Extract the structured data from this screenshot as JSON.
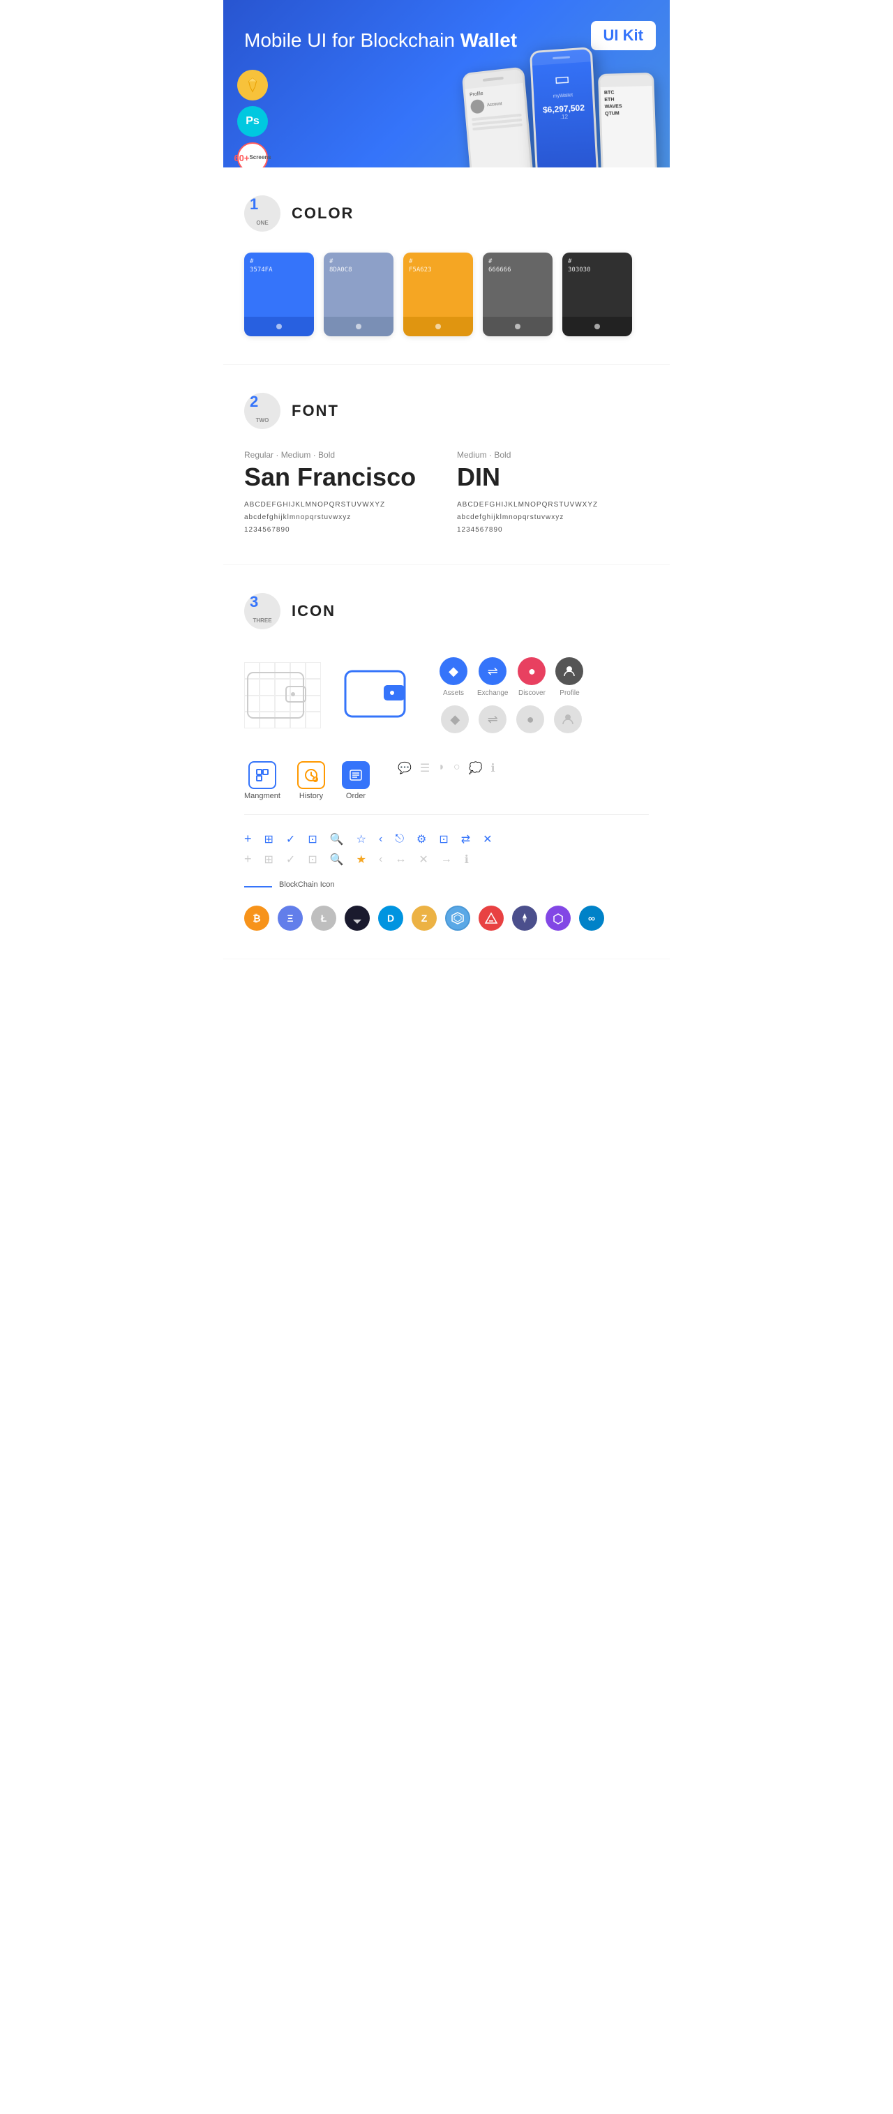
{
  "hero": {
    "title": "Mobile UI for Blockchain ",
    "title_bold": "Wallet",
    "badge": "UI Kit",
    "badges": [
      {
        "type": "sketch",
        "label": "S"
      },
      {
        "type": "ps",
        "label": "Ps"
      },
      {
        "type": "screens",
        "line1": "60+",
        "line2": "Screens"
      }
    ]
  },
  "sections": {
    "color": {
      "number": "1",
      "sub": "ONE",
      "title": "COLOR",
      "swatches": [
        {
          "color": "#3574FA",
          "code": "#\n3574FA"
        },
        {
          "color": "#8DA0C8",
          "code": "#\n8DA0C8"
        },
        {
          "color": "#F5A623",
          "code": "#\nF5A623"
        },
        {
          "color": "#666666",
          "code": "#\n666666"
        },
        {
          "color": "#303030",
          "code": "#\n303030"
        }
      ]
    },
    "font": {
      "number": "2",
      "sub": "TWO",
      "title": "FONT",
      "fonts": [
        {
          "weight_label": "Regular · Medium · Bold",
          "name": "San Francisco",
          "uppercase": "ABCDEFGHIJKLMNOPQRSTUVWXYZ",
          "lowercase": "abcdefghijklmnopqrstuvwxyz",
          "numbers": "1234567890"
        },
        {
          "weight_label": "Medium · Bold",
          "name": "DIN",
          "uppercase": "ABCDEFGHIJKLMNOPQRSTUVWXYZ",
          "lowercase": "abcdefghijklmnopqrstuvwxyz",
          "numbers": "1234567890"
        }
      ]
    },
    "icon": {
      "number": "3",
      "sub": "THREE",
      "title": "ICON",
      "nav_icons": [
        {
          "label": "Assets",
          "symbol": "◆"
        },
        {
          "label": "Exchange",
          "symbol": "↔"
        },
        {
          "label": "Discover",
          "symbol": "●"
        },
        {
          "label": "Profile",
          "symbol": "👤"
        }
      ],
      "mgmt_icons": [
        {
          "label": "Mangment",
          "type": "management"
        },
        {
          "label": "History",
          "type": "history"
        },
        {
          "label": "Order",
          "type": "order"
        }
      ],
      "small_icons": [
        "+",
        "⊞",
        "✓",
        "⊡",
        "🔍",
        "☆",
        "<",
        "<",
        "⚙",
        "⊡",
        "⇄",
        "✕"
      ],
      "small_icons_gray": [
        "+",
        "⊞",
        "✓",
        "⊡",
        "🔍",
        "☆",
        "<",
        "↔",
        "✕",
        "→",
        "ℹ"
      ],
      "blockchain_label": "BlockChain Icon",
      "crypto_icons": [
        {
          "symbol": "₿",
          "color": "#f7931a",
          "name": "Bitcoin"
        },
        {
          "symbol": "Ξ",
          "color": "#627eea",
          "name": "Ethereum"
        },
        {
          "symbol": "Ł",
          "color": "#bfbbbb",
          "name": "Litecoin"
        },
        {
          "symbol": "◈",
          "color": "#1d1d1d",
          "name": "Blackcoin"
        },
        {
          "symbol": "Đ",
          "color": "#0094e0",
          "name": "Dash"
        },
        {
          "symbol": "Z",
          "color": "#ecb244",
          "name": "Zcash"
        },
        {
          "symbol": "⬡",
          "color": "#5aa8e6",
          "name": "GridCoin"
        },
        {
          "symbol": "△",
          "color": "#e84142",
          "name": "Avax"
        },
        {
          "symbol": "◇",
          "color": "#4b4f8c",
          "name": "Ark"
        },
        {
          "symbol": "⬡",
          "color": "#8247e5",
          "name": "Matic"
        },
        {
          "symbol": "∞",
          "color": "#0082c8",
          "name": "Skycoin"
        }
      ]
    }
  }
}
